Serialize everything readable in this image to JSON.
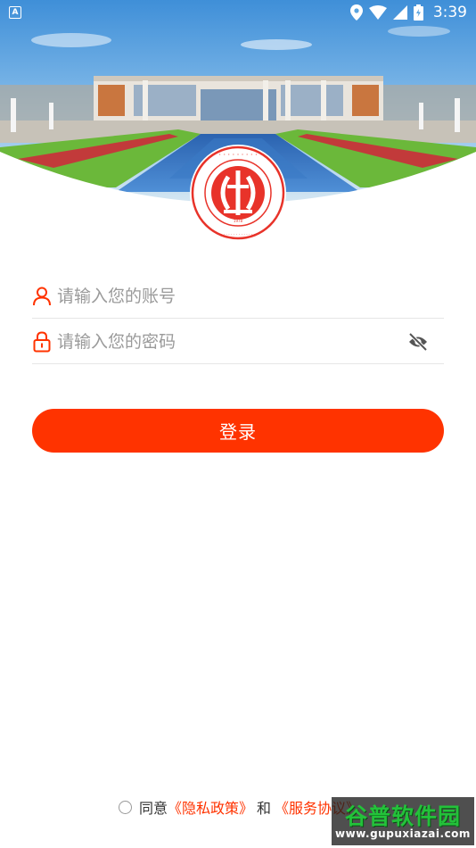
{
  "status_bar": {
    "notification": "A",
    "time": "3:39"
  },
  "login": {
    "account_placeholder": "请输入您的账号",
    "password_placeholder": "请输入您的密码",
    "button_label": "登录"
  },
  "agreement": {
    "prefix": "同意",
    "privacy_link": "《隐私政策》",
    "and": "和",
    "service_link": "《服务协议》"
  },
  "watermark": {
    "title": "谷普软件园",
    "url": "www.gupuxiazai.com"
  },
  "colors": {
    "accent": "#ff3300",
    "sky": "#5aa4e0",
    "lawn": "#6bb83a"
  }
}
